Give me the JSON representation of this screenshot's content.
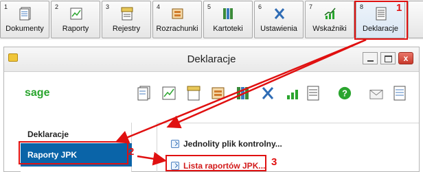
{
  "toolbar": {
    "buttons": [
      {
        "num": "1",
        "label": "Dokumenty",
        "icon": "documents-icon"
      },
      {
        "num": "2",
        "label": "Raporty",
        "icon": "chart-icon"
      },
      {
        "num": "3",
        "label": "Rejestry",
        "icon": "vat-register-icon"
      },
      {
        "num": "4",
        "label": "Rozrachunki",
        "icon": "settlements-icon"
      },
      {
        "num": "5",
        "label": "Kartoteki",
        "icon": "binders-icon"
      },
      {
        "num": "6",
        "label": "Ustawienia",
        "icon": "tools-icon"
      },
      {
        "num": "7",
        "label": "Wskaźniki",
        "icon": "growth-chart-icon"
      },
      {
        "num": "8",
        "label": "Deklaracje",
        "icon": "declarations-icon"
      }
    ]
  },
  "annotations": {
    "step1": "1",
    "step2": "2",
    "step3": "3"
  },
  "window": {
    "title": "Deklaracje",
    "close_glyph": "x"
  },
  "ribbon": {
    "logo": "sage"
  },
  "sidebar": {
    "title": "Deklaracje",
    "selected": "Raporty JPK"
  },
  "content": {
    "items": [
      {
        "label": "Jednolity plik kontrolny..."
      },
      {
        "label": "Lista raportów JPK..."
      }
    ]
  },
  "colors": {
    "accent_red": "#e01010",
    "selected_blue": "#0a64a8",
    "sage_green": "#2aa52e"
  }
}
